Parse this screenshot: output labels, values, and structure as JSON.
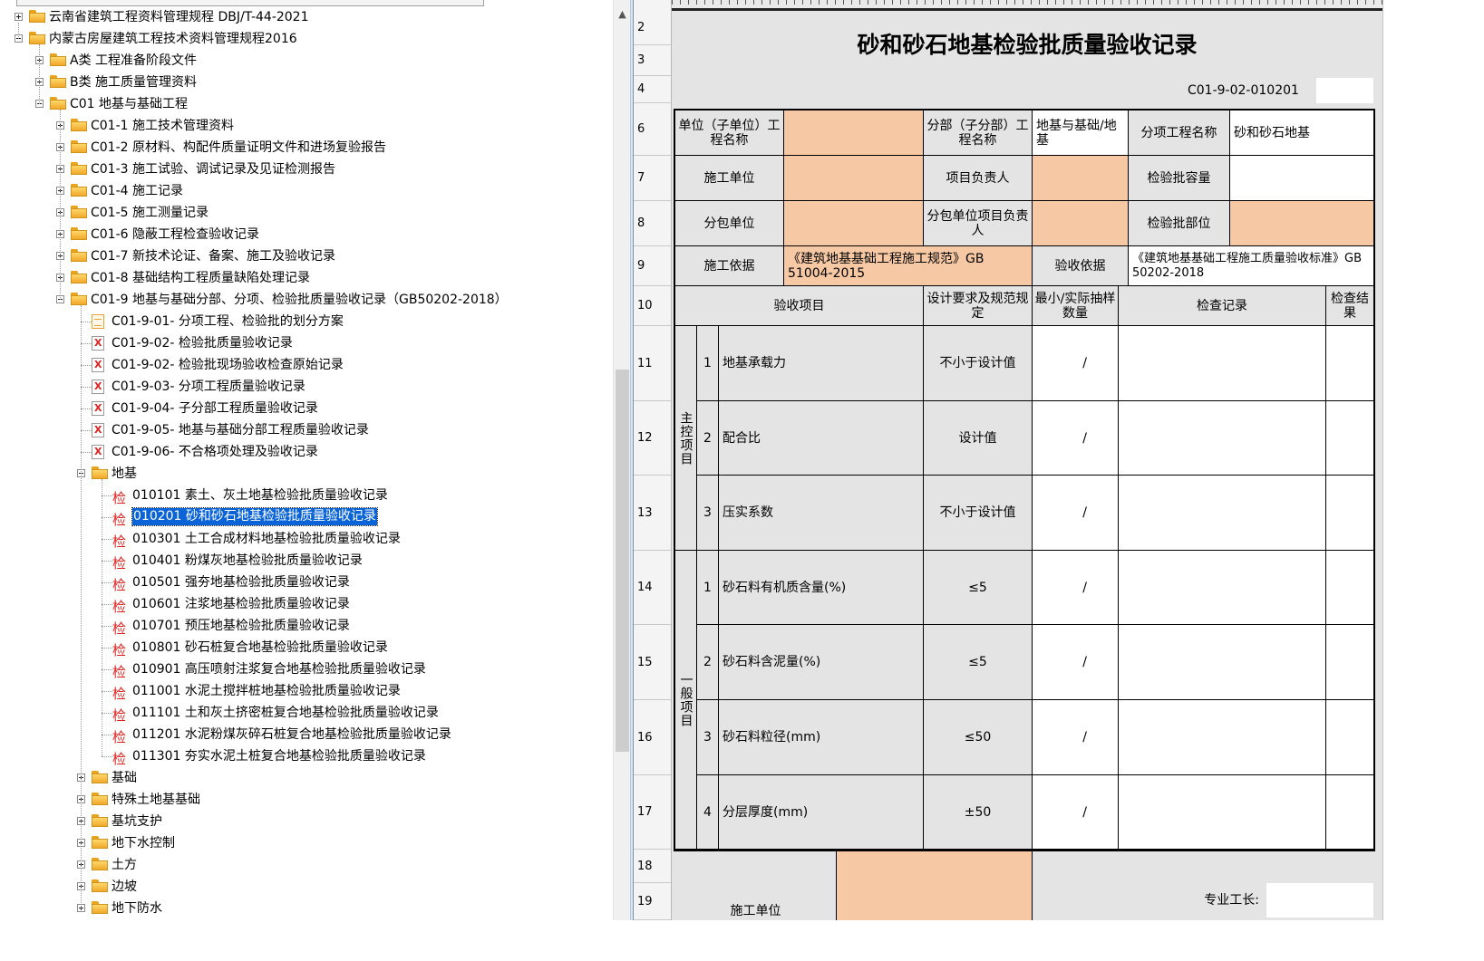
{
  "tree": {
    "selected_index": 23,
    "items": [
      {
        "label": "云南省建筑工程资料管理规程 DBJ/T-44-2021",
        "level": 0,
        "icon": "folder",
        "expand": "plus"
      },
      {
        "label": "内蒙古房屋建筑工程技术资料管理规程2016",
        "level": 0,
        "icon": "folder",
        "expand": "minus"
      },
      {
        "label": "A类 工程准备阶段文件",
        "level": 1,
        "icon": "folder",
        "expand": "plus"
      },
      {
        "label": "B类 施工质量管理资料",
        "level": 1,
        "icon": "folder",
        "expand": "plus"
      },
      {
        "label": "C01 地基与基础工程",
        "level": 1,
        "icon": "folder",
        "expand": "minus"
      },
      {
        "label": "C01-1 施工技术管理资料",
        "level": 2,
        "icon": "folder",
        "expand": "plus"
      },
      {
        "label": "C01-2 原材料、构配件质量证明文件和进场复验报告",
        "level": 2,
        "icon": "folder",
        "expand": "plus"
      },
      {
        "label": "C01-3 施工试验、调试记录及见证检测报告",
        "level": 2,
        "icon": "folder",
        "expand": "plus"
      },
      {
        "label": "C01-4 施工记录",
        "level": 2,
        "icon": "folder",
        "expand": "plus"
      },
      {
        "label": "C01-5 施工测量记录",
        "level": 2,
        "icon": "folder",
        "expand": "plus"
      },
      {
        "label": "C01-6 隐蔽工程检查验收记录",
        "level": 2,
        "icon": "folder",
        "expand": "plus"
      },
      {
        "label": "C01-7 新技术论证、备案、施工及验收记录",
        "level": 2,
        "icon": "folder",
        "expand": "plus"
      },
      {
        "label": "C01-8 基础结构工程质量缺陷处理记录",
        "level": 2,
        "icon": "folder",
        "expand": "plus"
      },
      {
        "label": "C01-9 地基与基础分部、分项、检验批质量验收记录（GB50202-2018）",
        "level": 2,
        "icon": "folder",
        "expand": "minus"
      },
      {
        "label": "C01-9-01- 分项工程、检验批的划分方案",
        "level": 3,
        "icon": "doc-text",
        "expand": ""
      },
      {
        "label": "C01-9-02- 检验批质量验收记录",
        "level": 3,
        "icon": "doc-xls",
        "expand": ""
      },
      {
        "label": "C01-9-02- 检验批现场验收检查原始记录",
        "level": 3,
        "icon": "doc-xls",
        "expand": ""
      },
      {
        "label": "C01-9-03- 分项工程质量验收记录",
        "level": 3,
        "icon": "doc-xls",
        "expand": ""
      },
      {
        "label": "C01-9-04- 子分部工程质量验收记录",
        "level": 3,
        "icon": "doc-xls",
        "expand": ""
      },
      {
        "label": "C01-9-05- 地基与基础分部工程质量验收记录",
        "level": 3,
        "icon": "doc-xls",
        "expand": ""
      },
      {
        "label": "C01-9-06- 不合格项处理及验收记录",
        "level": 3,
        "icon": "doc-xls",
        "expand": ""
      },
      {
        "label": "地基",
        "level": 3,
        "icon": "folder",
        "expand": "minus"
      },
      {
        "label": "010101 素土、灰土地基检验批质量验收记录",
        "level": 4,
        "icon": "jian",
        "expand": ""
      },
      {
        "label": "010201 砂和砂石地基检验批质量验收记录",
        "level": 4,
        "icon": "jian",
        "expand": ""
      },
      {
        "label": "010301 土工合成材料地基检验批质量验收记录",
        "level": 4,
        "icon": "jian",
        "expand": ""
      },
      {
        "label": "010401 粉煤灰地基检验批质量验收记录",
        "level": 4,
        "icon": "jian",
        "expand": ""
      },
      {
        "label": "010501 强夯地基检验批质量验收记录",
        "level": 4,
        "icon": "jian",
        "expand": ""
      },
      {
        "label": "010601 注浆地基检验批质量验收记录",
        "level": 4,
        "icon": "jian",
        "expand": ""
      },
      {
        "label": "010701 预压地基检验批质量验收记录",
        "level": 4,
        "icon": "jian",
        "expand": ""
      },
      {
        "label": "010801 砂石桩复合地基检验批质量验收记录",
        "level": 4,
        "icon": "jian",
        "expand": ""
      },
      {
        "label": "010901 高压喷射注浆复合地基检验批质量验收记录",
        "level": 4,
        "icon": "jian",
        "expand": ""
      },
      {
        "label": "011001 水泥土搅拌桩地基检验批质量验收记录",
        "level": 4,
        "icon": "jian",
        "expand": ""
      },
      {
        "label": "011101 土和灰土挤密桩复合地基检验批质量验收记录",
        "level": 4,
        "icon": "jian",
        "expand": ""
      },
      {
        "label": "011201 水泥粉煤灰碎石桩复合地基检验批质量验收记录",
        "level": 4,
        "icon": "jian",
        "expand": ""
      },
      {
        "label": "011301 夯实水泥土桩复合地基检验批质量验收记录",
        "level": 4,
        "icon": "jian",
        "expand": ""
      },
      {
        "label": "基础",
        "level": 3,
        "icon": "folder",
        "expand": "plus"
      },
      {
        "label": "特殊土地基基础",
        "level": 3,
        "icon": "folder",
        "expand": "plus"
      },
      {
        "label": "基坑支护",
        "level": 3,
        "icon": "folder",
        "expand": "plus"
      },
      {
        "label": "地下水控制",
        "level": 3,
        "icon": "folder",
        "expand": "plus"
      },
      {
        "label": "土方",
        "level": 3,
        "icon": "folder",
        "expand": "plus"
      },
      {
        "label": "边坡",
        "level": 3,
        "icon": "folder",
        "expand": "plus"
      },
      {
        "label": "地下防水",
        "level": 3,
        "icon": "folder",
        "expand": "plus"
      }
    ],
    "jian_glyph": "检"
  },
  "sheet": {
    "row_numbers": [
      "2",
      "3",
      "4",
      "6",
      "7",
      "8",
      "9",
      "10",
      "11",
      "12",
      "13",
      "14",
      "15",
      "16",
      "17",
      "18",
      "19"
    ],
    "title": "砂和砂石地基检验批质量验收记录",
    "code": "C01-9-02-010201",
    "header": {
      "unit_label": "单位（子单位）工程名称",
      "subdiv_label": "分部（子分部）工程名称",
      "subdiv_value": "地基与基础/地基",
      "item_label": "分项工程名称",
      "item_value": "砂和砂石地基",
      "constructor_label": "施工单位",
      "project_lead_label": "项目负责人",
      "batch_capacity_label": "检验批容量",
      "subcontractor_label": "分包单位",
      "sub_lead_label": "分包单位项目负责人",
      "batch_part_label": "检验批部位",
      "basis_label": "施工依据",
      "basis_value": "《建筑地基基础工程施工规范》GB 51004-2015",
      "accept_basis_label": "验收依据",
      "accept_basis_value": "《建筑地基基础工程施工质量验收标准》GB 50202-2018"
    },
    "columns": {
      "item": "验收项目",
      "design": "设计要求及规范规定",
      "sample": "最小/实际抽样数量",
      "record": "检查记录",
      "result": "检查结果"
    },
    "groups": {
      "main": "主控项目",
      "general": "一般项目"
    },
    "main_items": [
      {
        "no": "1",
        "name": "地基承载力",
        "design": "不小于设计值",
        "slash": "/"
      },
      {
        "no": "2",
        "name": "配合比",
        "design": "设计值",
        "slash": "/"
      },
      {
        "no": "3",
        "name": "压实系数",
        "design": "不小于设计值",
        "slash": "/"
      }
    ],
    "general_items": [
      {
        "no": "1",
        "name": "砂石料有机质含量(%)",
        "design": "≤5",
        "slash": "/"
      },
      {
        "no": "2",
        "name": "砂石料含泥量(%)",
        "design": "≤5",
        "slash": "/"
      },
      {
        "no": "3",
        "name": "砂石料粒径(mm)",
        "design": "≤50",
        "slash": "/"
      },
      {
        "no": "4",
        "name": "分层厚度(mm)",
        "design": "±50",
        "slash": "/"
      }
    ],
    "footer": {
      "constructor_label": "施工单位",
      "foreman_label": "专业工长:"
    }
  }
}
